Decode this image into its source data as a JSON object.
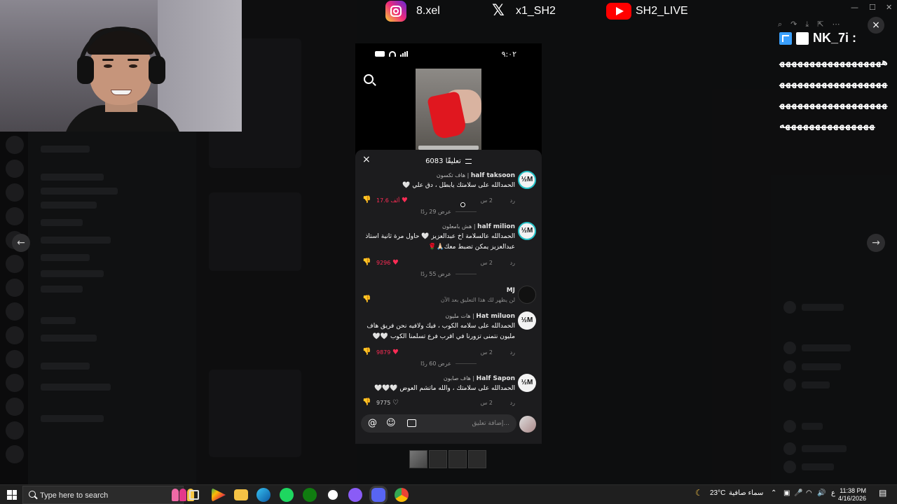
{
  "social": {
    "instagram": "8.xel",
    "x": "x1_SH2",
    "youtube": "SH2_LIVE"
  },
  "phone": {
    "status_time": "٩:٠٢",
    "comment_count": "6083 تعليقًا",
    "input_placeholder": "إضافة تعليق...",
    "comments": [
      {
        "name_ar": "هاف تكسون",
        "name_en": "half taksoon",
        "avatar": "½M",
        "text": "الحمدالله على سلامتك يابطل ، دق علي 🤍",
        "time": "2 س",
        "reply": "رد",
        "likes": "17.6 ألف",
        "view_replies": "عرض 29 ردًا"
      },
      {
        "name_ar": "هش بامعلون",
        "name_en": "half milion",
        "avatar": "½M",
        "text": "الحمدالله عالسلامة اخ عبدالعزيز 🤍 حاول مرة ثانية استاذ عبدالعزيز يمكن تضبط معك🙏🏻🌹",
        "time": "2 س",
        "reply": "رد",
        "likes": "9296",
        "view_replies": "عرض 55 ردًا"
      },
      {
        "name_ar": "",
        "name_en": "MJ",
        "avatar": "",
        "text": "لن يظهر لك هذا التعليق بعد الآن",
        "time": "",
        "reply": "",
        "likes": "",
        "view_replies": ""
      },
      {
        "name_ar": "هات مليون",
        "name_en": "Hat miluon",
        "avatar": "½M",
        "text": "الحمدالله على سلامه الكوب ، فيك ولافيه نحن فريق هاف مليون نتمنى تزورنا في اقرب فرع تسلمنا الكوب 🤍🤍",
        "time": "2 س",
        "reply": "رد",
        "likes": "9879",
        "view_replies": "عرض 60 ردًا"
      },
      {
        "name_ar": "هاف صابون",
        "name_en": "Half Sapon",
        "avatar": "½M",
        "text": "الحمدالله على سلامتك ، والله ماتشم العوض 🤍🤍🤍",
        "time": "2 س",
        "reply": "رد",
        "likes": "9775",
        "view_replies": ""
      }
    ]
  },
  "chat": {
    "username": "NK_7i :",
    "message": "هههههههههههههههههههههههههههههههههههههههههههههههههههههههههههههههههههههه"
  },
  "taskbar": {
    "search_placeholder": "Type here to search",
    "weather_temp": "23°C",
    "weather_desc": "سماء صافية",
    "lang": "ع",
    "time": "11:38 PM",
    "date": "4/16/2026"
  },
  "colors": {
    "like_red": "#fe2c55",
    "sheet_bg": "#1c1c1e",
    "avatar_ring": "#27c3c8"
  },
  "icons": {
    "close": "×",
    "nav_left": "←",
    "nav_right": "→"
  }
}
